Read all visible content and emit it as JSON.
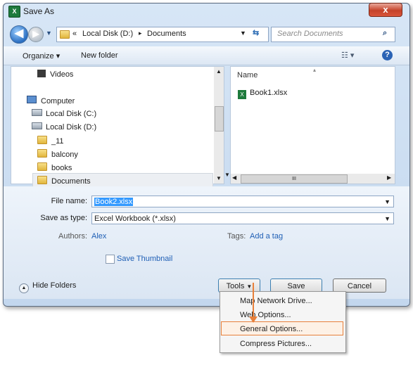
{
  "window": {
    "title": "Save As",
    "app_icon": "excel-icon",
    "close_label": "x"
  },
  "nav": {
    "breadcrumb_prefix": "«",
    "breadcrumb": [
      "Local Disk (D:)",
      "Documents"
    ],
    "separator": "▸",
    "search_placeholder": "Search Documents"
  },
  "toolbar": {
    "organize": "Organize ▾",
    "new_folder": "New folder",
    "views": "☷ ▾",
    "help": "?"
  },
  "tree": [
    {
      "label": "Videos",
      "icon": "video-library-icon"
    },
    {
      "label": "Computer",
      "icon": "computer-icon"
    },
    {
      "label": "Local Disk (C:)",
      "icon": "drive-icon"
    },
    {
      "label": "Local Disk (D:)",
      "icon": "drive-icon"
    },
    {
      "label": "_11",
      "icon": "folder-icon"
    },
    {
      "label": "balcony",
      "icon": "folder-icon"
    },
    {
      "label": "books",
      "icon": "folder-icon"
    },
    {
      "label": "Documents",
      "icon": "folder-icon",
      "selected": true
    }
  ],
  "files": {
    "column_header": "Name",
    "items": [
      {
        "name": "Book1.xlsx",
        "icon": "excel-file-icon"
      }
    ],
    "hscroll_marker": "III"
  },
  "form": {
    "file_name_label": "File name:",
    "file_name_value": "Book2.xlsx",
    "save_type_label": "Save as type:",
    "save_type_value": "Excel Workbook (*.xlsx)",
    "authors_label": "Authors:",
    "authors_value": "Alex",
    "tags_label": "Tags:",
    "tags_value": "Add a tag",
    "thumbnail_label": "Save Thumbnail",
    "thumbnail_checked": false
  },
  "footer": {
    "hide_folders": "Hide Folders",
    "tools": "Tools",
    "save": "Save",
    "cancel": "Cancel"
  },
  "tools_menu": [
    {
      "label": "Map Network Drive...",
      "highlighted": false
    },
    {
      "label": "Web Options...",
      "highlighted": false
    },
    {
      "label": "General Options...",
      "highlighted": true
    },
    {
      "label": "Compress Pictures...",
      "highlighted": false
    }
  ],
  "colors": {
    "highlight_border": "#e8803a",
    "selection": "#3399ff",
    "link": "#1f5fb5"
  }
}
